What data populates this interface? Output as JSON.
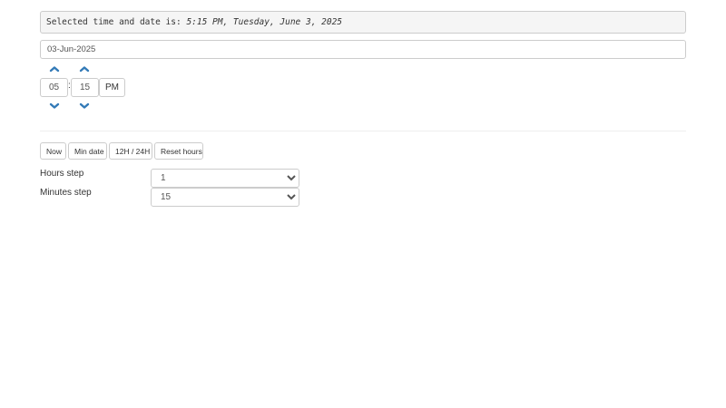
{
  "summary": {
    "prefix": "Selected time and date is: ",
    "value": "5:15 PM, Tuesday, June 3, 2025"
  },
  "date_input": {
    "value": "03-Jun-2025"
  },
  "timepicker": {
    "hours": "05",
    "separator": ":",
    "minutes": "15",
    "meridian": "PM",
    "icons": {
      "increment": "chevron-up-icon",
      "decrement": "chevron-down-icon"
    },
    "accent_color": "#337ab7"
  },
  "toolbar": {
    "now_label": "Now",
    "min_date_label": "Min date",
    "toggle_format_label": "12H / 24H",
    "reset_hours_label": "Reset hours"
  },
  "settings": {
    "hours_step_label": "Hours step",
    "hours_step_value": "1",
    "minutes_step_label": "Minutes step",
    "minutes_step_value": "15"
  }
}
